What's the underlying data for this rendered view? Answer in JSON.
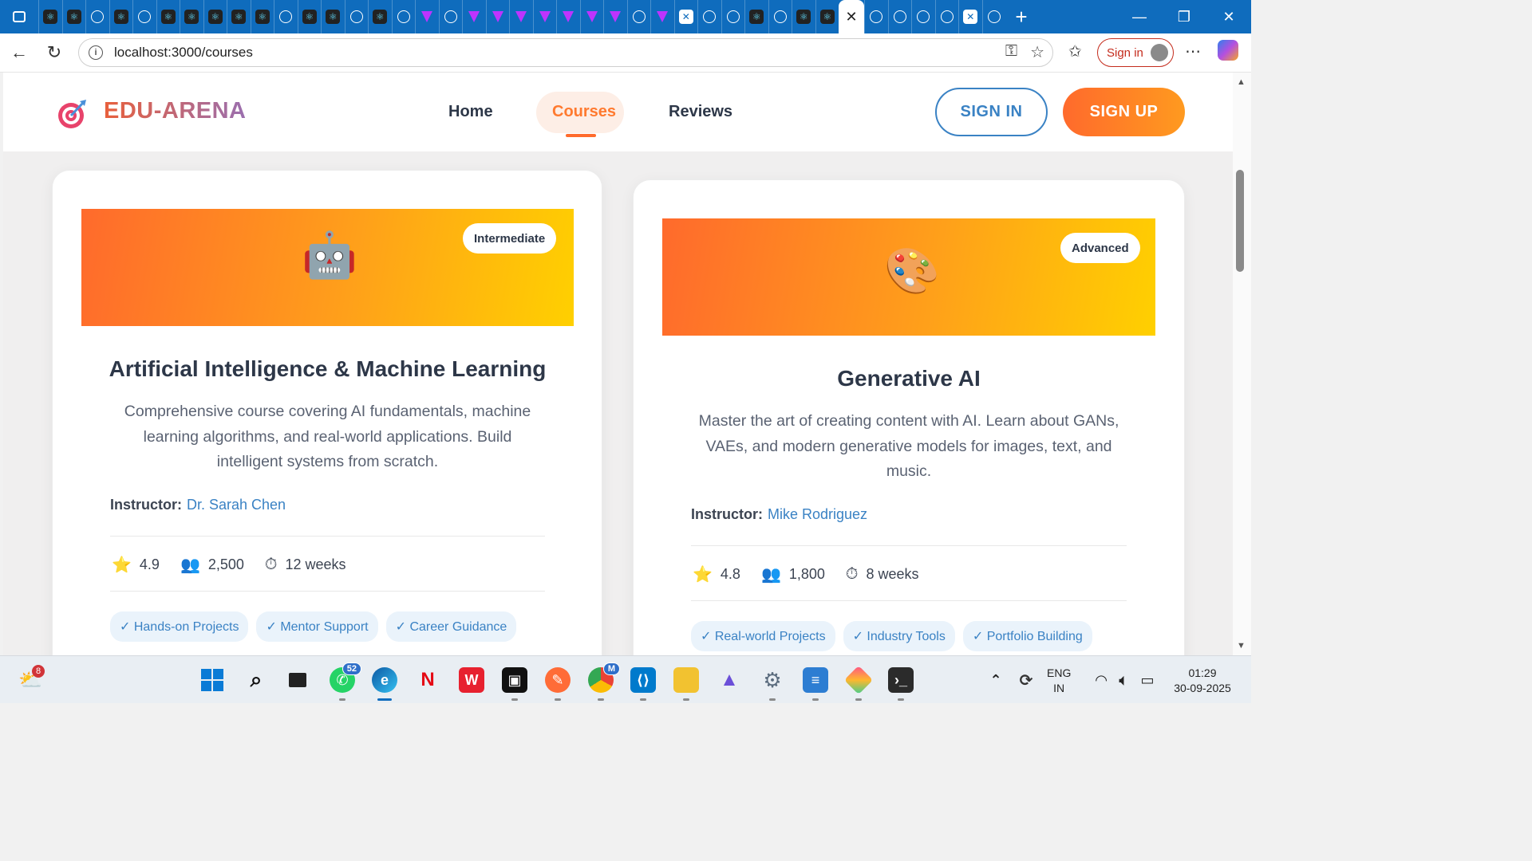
{
  "browser": {
    "url": "localhost:3000/courses",
    "signin_label": "Sign in",
    "tab_icons": [
      "react",
      "react",
      "globe",
      "react",
      "globe",
      "react",
      "react",
      "react",
      "react",
      "react",
      "globe",
      "react",
      "react",
      "globe",
      "react",
      "globe",
      "vite",
      "globe",
      "vite",
      "vite",
      "vite",
      "vite",
      "vite",
      "vite",
      "vite",
      "globe",
      "vite",
      "shop",
      "globe",
      "globe",
      "react",
      "globe",
      "react",
      "react"
    ],
    "tabs_after": [
      "globe",
      "globe",
      "globe",
      "globe",
      "shop",
      "globe"
    ],
    "close_glyph": "✕",
    "new_tab_glyph": "+",
    "window_controls": [
      "—",
      "❐",
      "✕"
    ]
  },
  "site": {
    "brand": "EDU-ARENA",
    "nav": [
      "Home",
      "Courses",
      "Reviews"
    ],
    "signin": "SIGN IN",
    "signup": "SIGN UP"
  },
  "courses": [
    {
      "level": "Intermediate",
      "emoji": "🤖",
      "title": "Artificial Intelligence & Machine Learning",
      "description": "Comprehensive course covering AI fundamentals, machine learning algorithms, and real-world applications. Build intelligent systems from scratch.",
      "instructor_label": "Instructor:",
      "instructor": "Dr. Sarah Chen",
      "rating": "4.9",
      "students": "2,500",
      "duration": "12 weeks",
      "tags": [
        "✓ Hands-on Projects",
        "✓ Mentor Support",
        "✓ Career Guidance"
      ]
    },
    {
      "level": "Advanced",
      "emoji": "🎨",
      "title": "Generative AI",
      "description": "Master the art of creating content with AI. Learn about GANs, VAEs, and modern generative models for images, text, and music.",
      "instructor_label": "Instructor:",
      "instructor": "Mike Rodriguez",
      "rating": "4.8",
      "students": "1,800",
      "duration": "8 weeks",
      "tags": [
        "✓ Real-world Projects",
        "✓ Industry Tools",
        "✓ Portfolio Building"
      ]
    }
  ],
  "taskbar": {
    "weather_badge": "8",
    "whatsapp_badge": "52",
    "chrome_badge": "M",
    "lang_line1": "ENG",
    "lang_line2": "IN",
    "time": "01:29",
    "date": "30-09-2025"
  }
}
